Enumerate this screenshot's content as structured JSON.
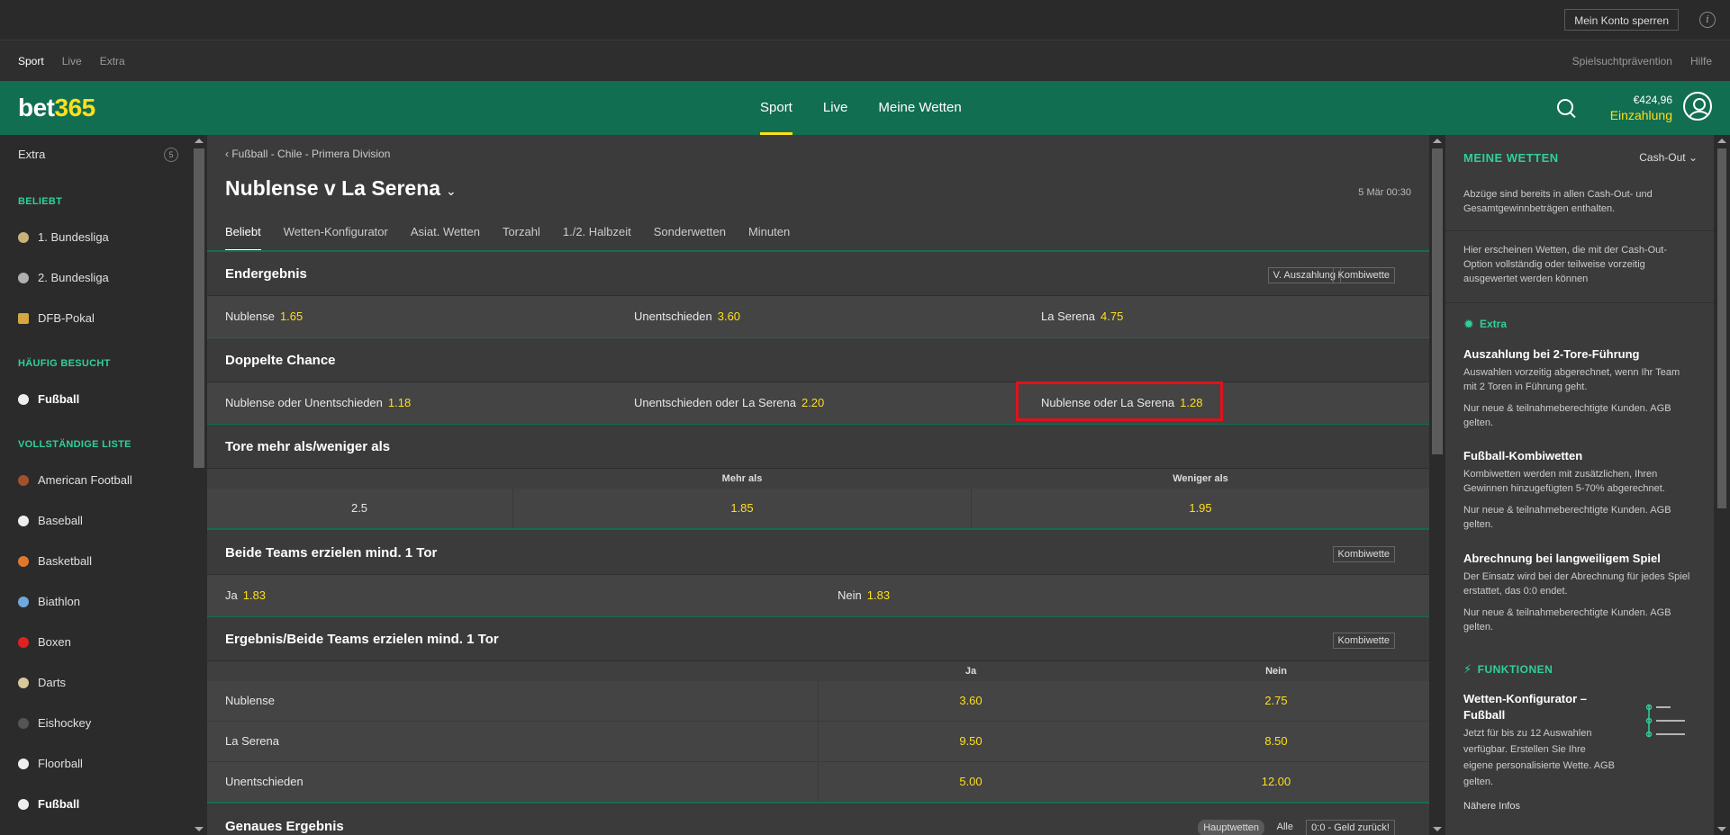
{
  "topbar": {
    "lock_label": "Mein Konto sperren",
    "info_label": "i"
  },
  "subnav": {
    "left": [
      "Sport",
      "Live",
      "Extra"
    ],
    "right": [
      "Spielsuchtprävention",
      "Hilfe"
    ]
  },
  "header": {
    "logo_white": "bet",
    "logo_yellow": "365",
    "nav": [
      "Sport",
      "Live",
      "Meine Wetten"
    ],
    "balance": "€424,96",
    "deposit": "Einzahlung"
  },
  "leftnav": {
    "extra_label": "Extra",
    "extra_badge": "5",
    "sec_popular": "BELIEBT",
    "popular": [
      "1. Bundesliga",
      "2. Bundesliga",
      "DFB-Pokal"
    ],
    "sec_frequent": "HÄUFIG BESUCHT",
    "frequent": [
      "Fußball"
    ],
    "sec_full": "VOLLSTÄNDIGE LISTE",
    "full": [
      "American Football",
      "Baseball",
      "Basketball",
      "Biathlon",
      "Boxen",
      "Darts",
      "Eishockey",
      "Floorball",
      "Fußball"
    ]
  },
  "event": {
    "breadcrumb": "Fußball - Chile - Primera Division",
    "title": "Nublense v La Serena",
    "date": "5 Mär 00:30",
    "tabs": [
      "Beliebt",
      "Wetten-Konfigurator",
      "Asiat. Wetten",
      "Torzahl",
      "1./2. Halbzeit",
      "Sonderwetten",
      "Minuten"
    ]
  },
  "markets": {
    "endergebnis": {
      "name": "Endergebnis",
      "tag1": "V. Auszahlung",
      "tag2": "Kombiwette",
      "o1": {
        "label": "Nublense",
        "odd": "1.65"
      },
      "o2": {
        "label": "Unentschieden",
        "odd": "3.60"
      },
      "o3": {
        "label": "La Serena",
        "odd": "4.75"
      }
    },
    "doppelte": {
      "name": "Doppelte Chance",
      "o1": {
        "label": "Nublense oder Unentschieden",
        "odd": "1.18"
      },
      "o2": {
        "label": "Unentschieden oder La Serena",
        "odd": "2.20"
      },
      "o3": {
        "label": "Nublense oder La Serena",
        "odd": "1.28"
      }
    },
    "tore": {
      "name": "Tore mehr als/weniger als",
      "col1": "Mehr als",
      "col2": "Weniger als",
      "line": "2.5",
      "over": "1.85",
      "under": "1.95"
    },
    "beide": {
      "name": "Beide Teams erzielen mind. 1 Tor",
      "tag": "Kombiwette",
      "o1": {
        "label": "Ja",
        "odd": "1.83"
      },
      "o2": {
        "label": "Nein",
        "odd": "1.83"
      }
    },
    "ergebnis_beide": {
      "name": "Ergebnis/Beide Teams erzielen mind. 1 Tor",
      "tag": "Kombiwette",
      "col1": "Ja",
      "col2": "Nein",
      "rows": [
        {
          "label": "Nublense",
          "ja": "3.60",
          "nein": "2.75"
        },
        {
          "label": "La Serena",
          "ja": "9.50",
          "nein": "8.50"
        },
        {
          "label": "Unentschieden",
          "ja": "5.00",
          "nein": "12.00"
        }
      ]
    },
    "genaues": {
      "name": "Genaues Ergebnis",
      "tag1": "Hauptwetten",
      "tag2": "Alle",
      "tag3": "0:0 - Geld zurück!"
    }
  },
  "rightpanel": {
    "title": "MEINE WETTEN",
    "cashout": "Cash-Out",
    "text1": "Abzüge sind bereits in allen Cash-Out- und Gesamtgewinnbeträgen enthalten.",
    "text2": "Hier erscheinen Wetten, die mit der Cash-Out-Option vollständig oder teilweise vorzeitig ausgewertet werden können",
    "sec_extra": "Extra",
    "promo1_h": "Auszahlung bei 2-Tore-Führung",
    "promo1_t": "Auswahlen vorzeitig abgerechnet, wenn Ihr Team mit 2 Toren in Führung geht.",
    "promo1_n": "Nur neue & teilnahmeberechtigte Kunden. AGB gelten.",
    "promo2_h": "Fußball-Kombiwetten",
    "promo2_t": "Kombiwetten werden mit zusätzlichen, Ihren Gewinnen hinzugefügten 5-70% abgerechnet.",
    "promo2_n": "Nur neue & teilnahmeberechtigte Kunden. AGB gelten.",
    "promo3_h": "Abrechnung bei langweiligem Spiel",
    "promo3_t": "Der Einsatz wird bei der Abrechnung für jedes Spiel erstattet, das 0:0 endet.",
    "promo3_n": "Nur neue & teilnahmeberechtigte Kunden. AGB gelten.",
    "sec_func": "FUNKTIONEN",
    "func_h": "Wetten-Konfigurator – Fußball",
    "func_t": "Jetzt für bis zu 12 Auswahlen verfügbar. Erstellen Sie Ihre eigene personalisierte Wette. AGB gelten.",
    "func_more": "Nähere Infos"
  },
  "colors": {
    "green": "#126e51",
    "accent_green": "#2fd09b",
    "yellow": "#ffdf1b",
    "highlight": "#e0121c"
  }
}
